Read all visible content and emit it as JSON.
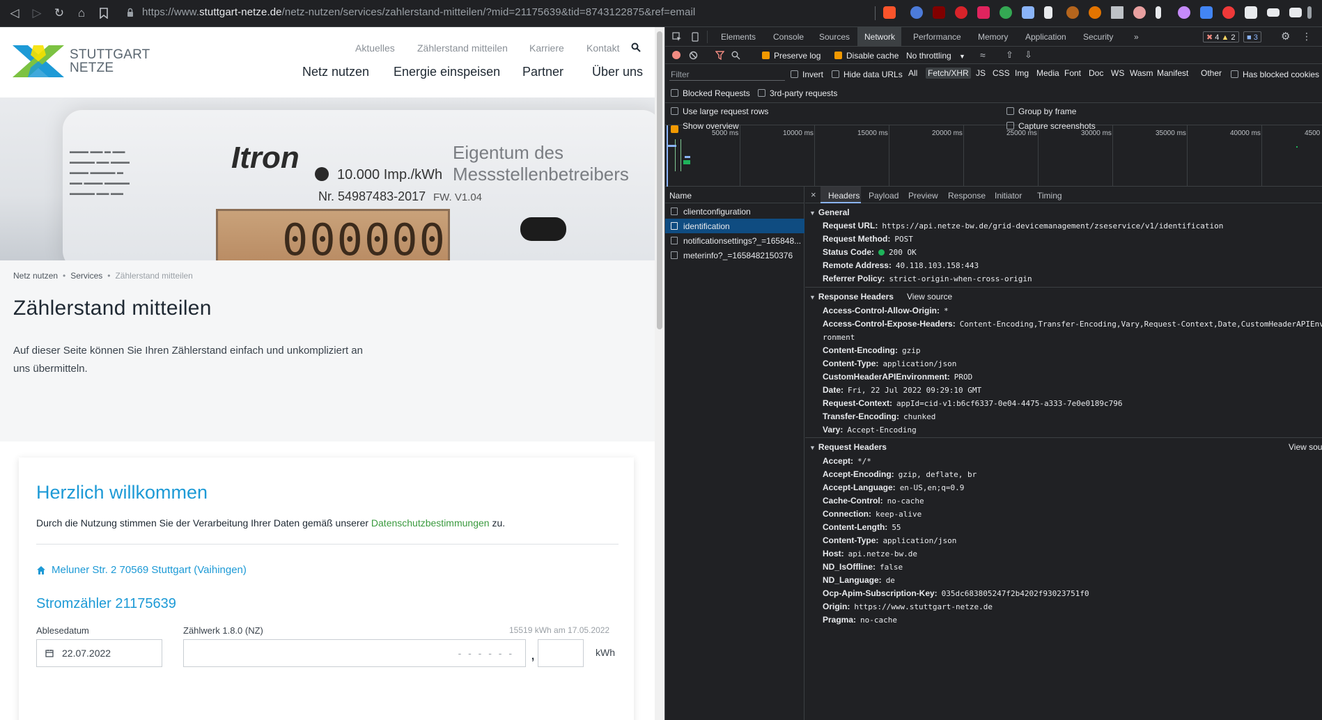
{
  "browser": {
    "url_prefix": "https://www.",
    "url_host": "stuttgart-netze.de",
    "url_path": "/netz-nutzen/services/zahlerstand-mitteilen/?mid=21175639&tid=8743122875&ref=email",
    "nav_icons": [
      "back-icon",
      "forward-icon",
      "reload-icon",
      "home-icon",
      "bookmark-icon"
    ]
  },
  "site": {
    "logo_line1": "STUTTGART",
    "logo_line2": "NETZE",
    "top_links": [
      "Aktuelles",
      "Zählerstand mitteilen",
      "Karriere",
      "Kontakt"
    ],
    "main_links": [
      "Netz nutzen",
      "Energie einspeisen",
      "Partner",
      "Über uns"
    ],
    "hero": {
      "brand": "Itron",
      "spec": "10.000 Imp./kWh",
      "serial": "Nr. 54987483-2017",
      "owner": "Eigentum des Messstellenbetreibers",
      "fw": "FW. V1.04",
      "digits": "000000"
    },
    "breadcrumb": [
      "Netz nutzen",
      "Services",
      "Zählerstand mitteilen"
    ],
    "page_title": "Zählerstand mitteilen",
    "intro": "Auf dieser Seite können Sie Ihren Zählerstand einfach und unkompliziert an uns übermitteln.",
    "card": {
      "welcome": "Herzlich willkommen",
      "consent_before": "Durch die Nutzung stimmen Sie der Verarbeitung Ihrer Daten gemäß unserer ",
      "consent_link": "Datenschutzbestimmungen",
      "consent_after": " zu.",
      "address": "Meluner Str. 2 70569 Stuttgart (Vaihingen)",
      "meter_title": "Stromzähler 21175639",
      "date_label": "Ablesedatum",
      "date_value": "22.07.2022",
      "register_label": "Zählwerk 1.8.0 (NZ)",
      "last_reading": "15519 kWh  am  17.05.2022",
      "integer_placeholder": "- - - - - -",
      "comma": ",",
      "unit": "kWh"
    }
  },
  "devtools": {
    "tabs": [
      "Elements",
      "Console",
      "Sources",
      "Network",
      "Performance",
      "Memory",
      "Application",
      "Security",
      "»"
    ],
    "active_tab": "Network",
    "badges": {
      "errors": "4",
      "warnings": "2",
      "messages": "3"
    },
    "toolbar": {
      "preserve_log": "Preserve log",
      "disable_cache": "Disable cache",
      "throttling": "No throttling"
    },
    "filter": {
      "placeholder": "Filter",
      "invert": "Invert",
      "hide_data_urls": "Hide data URLs",
      "types": [
        "All",
        "Fetch/XHR",
        "JS",
        "CSS",
        "Img",
        "Media",
        "Font",
        "Doc",
        "WS",
        "Wasm",
        "Manifest",
        "Other"
      ],
      "active_type": "Fetch/XHR",
      "has_blocked_cookies": "Has blocked cookies",
      "blocked_requests": "Blocked Requests",
      "third_party": "3rd-party requests",
      "large_rows": "Use large request rows",
      "group_by_frame": "Group by frame",
      "show_overview": "Show overview",
      "capture_screenshots": "Capture screenshots"
    },
    "overview_ticks": [
      "5000 ms",
      "10000 ms",
      "15000 ms",
      "20000 ms",
      "25000 ms",
      "30000 ms",
      "35000 ms",
      "40000 ms",
      "4500"
    ],
    "list_header": "Name",
    "requests": [
      {
        "name": "clientconfiguration",
        "selected": false
      },
      {
        "name": "identification",
        "selected": true
      },
      {
        "name": "notificationsettings?_=165848...",
        "selected": false
      },
      {
        "name": "meterinfo?_=1658482150376",
        "selected": false
      }
    ],
    "detail_tabs": [
      "Headers",
      "Payload",
      "Preview",
      "Response",
      "Initiator",
      "Timing"
    ],
    "active_detail_tab": "Headers",
    "general_title": "General",
    "general": [
      {
        "k": "Request URL:",
        "v": "https://api.netze-bw.de/grid-devicemanagement/zseservice/v1/identification"
      },
      {
        "k": "Request Method:",
        "v": "POST"
      },
      {
        "k": "Status Code:",
        "v": "200 OK"
      },
      {
        "k": "Remote Address:",
        "v": "40.118.103.158:443"
      },
      {
        "k": "Referrer Policy:",
        "v": "strict-origin-when-cross-origin"
      }
    ],
    "response_title": "Response Headers",
    "view_source": "View source",
    "view_source_cut": "View sou",
    "response": [
      {
        "k": "Access-Control-Allow-Origin:",
        "v": "*"
      },
      {
        "k": "Access-Control-Expose-Headers:",
        "v": "Content-Encoding,Transfer-Encoding,Vary,Request-Context,Date,CustomHeaderAPIEnvi"
      },
      {
        "k": "",
        "v": "ronment"
      },
      {
        "k": "Content-Encoding:",
        "v": "gzip"
      },
      {
        "k": "Content-Type:",
        "v": "application/json"
      },
      {
        "k": "CustomHeaderAPIEnvironment:",
        "v": "PROD"
      },
      {
        "k": "Date:",
        "v": "Fri, 22 Jul 2022 09:29:10 GMT"
      },
      {
        "k": "Request-Context:",
        "v": "appId=cid-v1:b6cf6337-0e04-4475-a333-7e0e0189c796"
      },
      {
        "k": "Transfer-Encoding:",
        "v": "chunked"
      },
      {
        "k": "Vary:",
        "v": "Accept-Encoding"
      }
    ],
    "request_title": "Request Headers",
    "request": [
      {
        "k": "Accept:",
        "v": "*/*"
      },
      {
        "k": "Accept-Encoding:",
        "v": "gzip, deflate, br"
      },
      {
        "k": "Accept-Language:",
        "v": "en-US,en;q=0.9"
      },
      {
        "k": "Cache-Control:",
        "v": "no-cache"
      },
      {
        "k": "Connection:",
        "v": "keep-alive"
      },
      {
        "k": "Content-Length:",
        "v": "55"
      },
      {
        "k": "Content-Type:",
        "v": "application/json"
      },
      {
        "k": "Host:",
        "v": "api.netze-bw.de"
      },
      {
        "k": "ND_IsOffline:",
        "v": "false"
      },
      {
        "k": "ND_Language:",
        "v": "de"
      },
      {
        "k": "Ocp-Apim-Subscription-Key:",
        "v": "035dc683805247f2b4202f93023751f0"
      },
      {
        "k": "Origin:",
        "v": "https://www.stuttgart-netze.de"
      },
      {
        "k": "Pragma:",
        "v": "no-cache"
      }
    ]
  },
  "colors": {
    "accent_blue": "#1d9ad6",
    "link_green": "#3a9a3e",
    "devtools_bg": "#202124",
    "selected_row": "#0f4c81",
    "status_ok": "#1eb35a"
  }
}
